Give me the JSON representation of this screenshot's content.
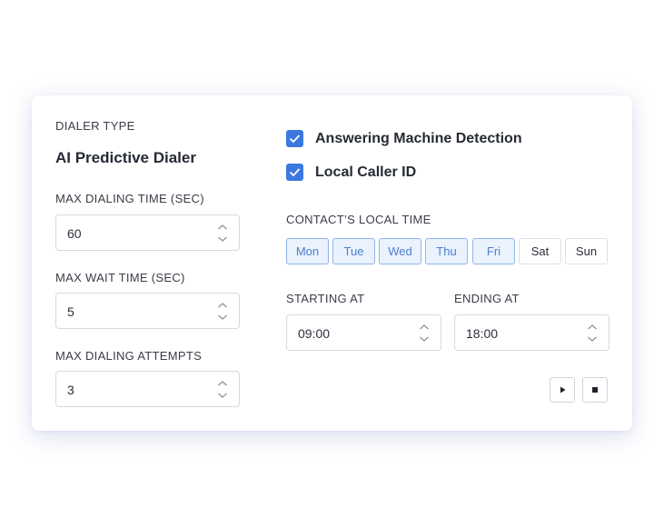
{
  "left": {
    "dialer_type_label": "DIALER TYPE",
    "dialer_type_value": "AI Predictive Dialer",
    "max_dialing_time_label": "MAX DIALING TIME (SEC)",
    "max_dialing_time_value": "60",
    "max_wait_time_label": "MAX WAIT TIME (SEC)",
    "max_wait_time_value": "5",
    "max_attempts_label": "MAX DIALING ATTEMPTS",
    "max_attempts_value": "3"
  },
  "right": {
    "amd_label": "Answering Machine Detection",
    "amd_checked": true,
    "caller_id_label": "Local Caller ID",
    "caller_id_checked": true,
    "local_time_label": "CONTACT’S LOCAL TIME",
    "days": [
      {
        "label": "Mon",
        "selected": true
      },
      {
        "label": "Tue",
        "selected": true
      },
      {
        "label": "Wed",
        "selected": true
      },
      {
        "label": "Thu",
        "selected": true
      },
      {
        "label": "Fri",
        "selected": true
      },
      {
        "label": "Sat",
        "selected": false
      },
      {
        "label": "Sun",
        "selected": false
      }
    ],
    "starting_label": "STARTING AT",
    "starting_value": "09:00",
    "ending_label": "ENDING AT",
    "ending_value": "18:00"
  },
  "controls": {
    "play_icon": "play-icon",
    "stop_icon": "stop-icon"
  },
  "colors": {
    "accent": "#3b78e0",
    "day_selected_bg": "#eaf2fd",
    "day_selected_border": "#8fb5ec"
  }
}
